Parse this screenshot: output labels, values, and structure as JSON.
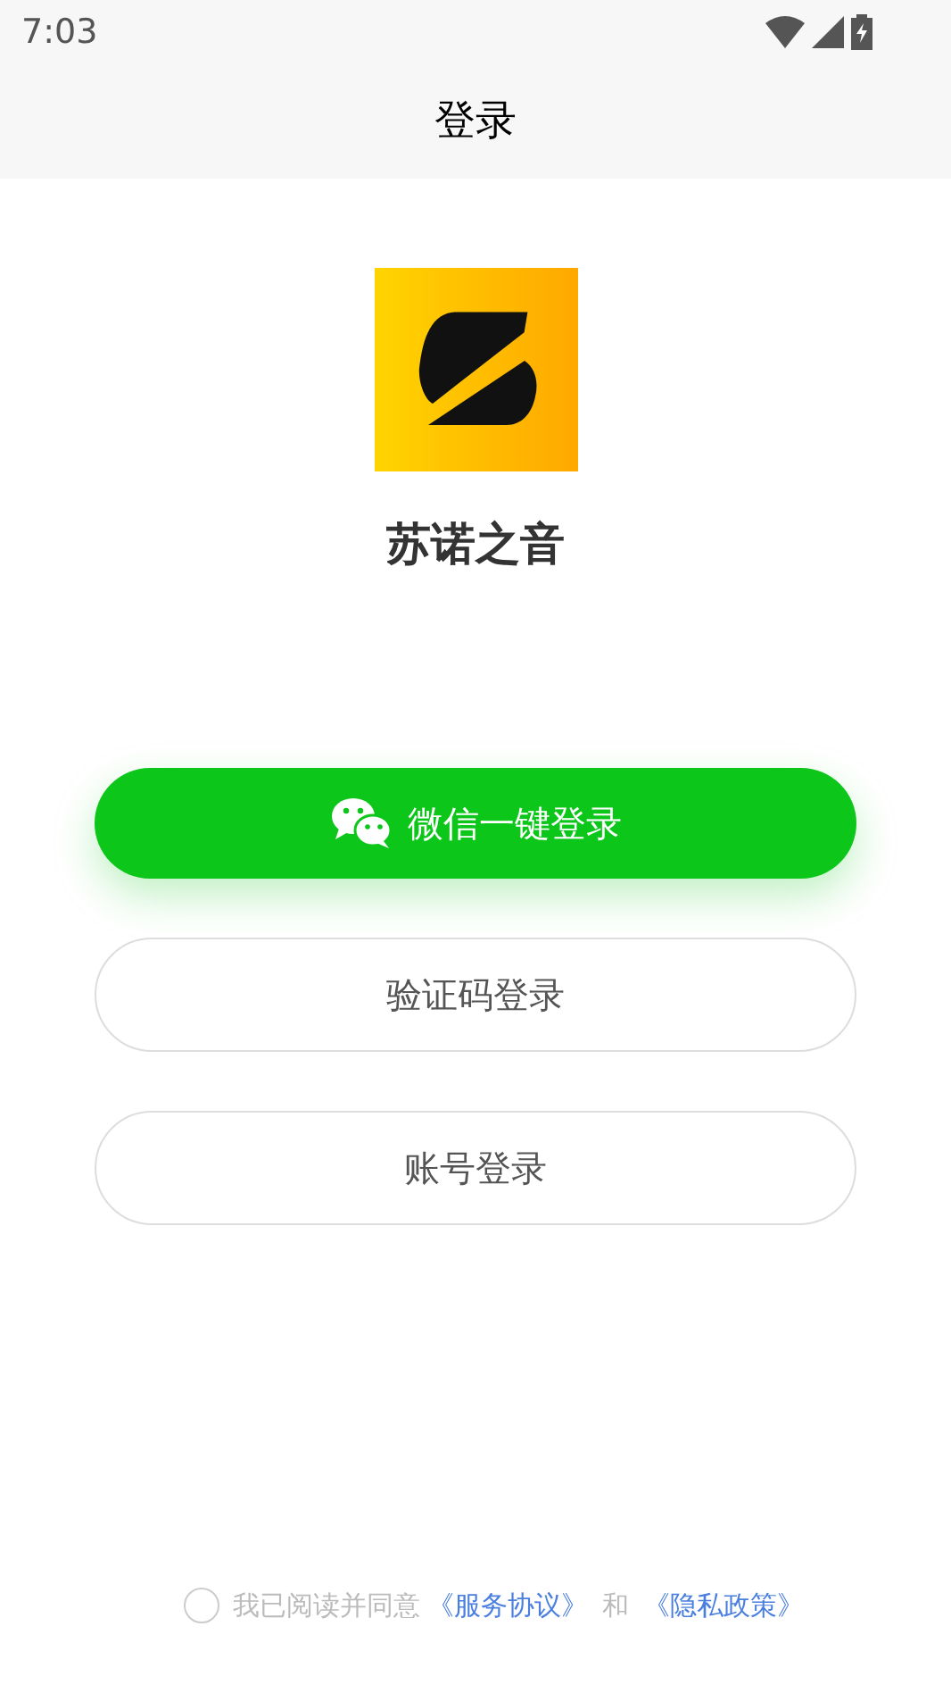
{
  "status_bar": {
    "time": "7:03"
  },
  "header": {
    "title": "登录"
  },
  "app": {
    "name": "苏诺之音"
  },
  "buttons": [
    {
      "kind": "wechat",
      "label": "微信一键登录"
    },
    {
      "kind": "outline",
      "label": "验证码登录"
    },
    {
      "kind": "outline",
      "label": "账号登录"
    }
  ],
  "agreement": {
    "checked": false,
    "text": "我已阅读并同意",
    "link_1": "《服务协议》",
    "joiner": "和",
    "link_2": "《隐私政策》"
  }
}
